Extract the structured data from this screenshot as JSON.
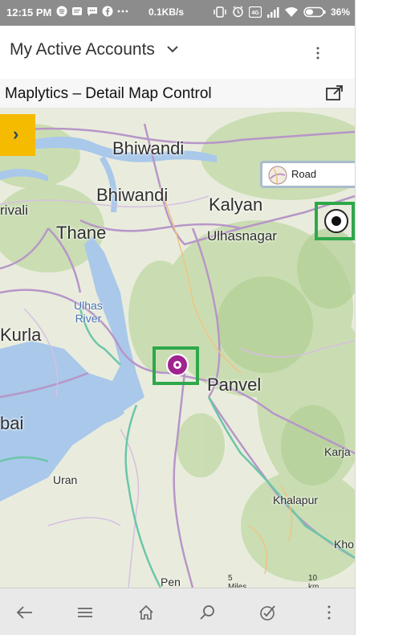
{
  "status_bar": {
    "time": "12:15 PM",
    "network_speed": "0.1KB/s",
    "battery": "36%",
    "icons": [
      "spotify-icon",
      "notification-icon",
      "message-icon",
      "facebook-icon",
      "more-dots-icon",
      "vibrate-icon",
      "alarm-icon",
      "volte-icon",
      "signal-icon",
      "wifi-icon",
      "battery-icon"
    ]
  },
  "header": {
    "title": "My Active Accounts",
    "menu_icon": "more-vertical-icon"
  },
  "map_card": {
    "title": "Maplytics – Detail Map Control",
    "expand_icon": "popout-icon",
    "road_button_label": "Road",
    "scale": {
      "miles": "5 Miles",
      "km": "10 km"
    },
    "places": {
      "bhiwandi_top": "Bhiwandi",
      "bhiwandi": "Bhiwandi",
      "kalyan": "Kalyan",
      "ulhasnagar": "Ulhasnagar",
      "thane": "Thane",
      "rivali": "rivali",
      "ulhas_river": "Ulhas\nRiver",
      "kurla": "Kurla",
      "panvel": "Panvel",
      "bai": "bai",
      "karja": "Karja",
      "uran": "Uran",
      "khalapur": "Khalapur",
      "kho": "Kho",
      "pen": "Pen"
    }
  },
  "colors": {
    "accent_highlight": "#2ea84a",
    "pin": "#a0238f",
    "toggle_bg": "#f5bb00",
    "water": "#a9c8ea"
  },
  "bottom_nav": [
    "back-icon",
    "menu-icon",
    "home-icon",
    "search-icon",
    "tasks-icon",
    "more-vertical-icon"
  ]
}
